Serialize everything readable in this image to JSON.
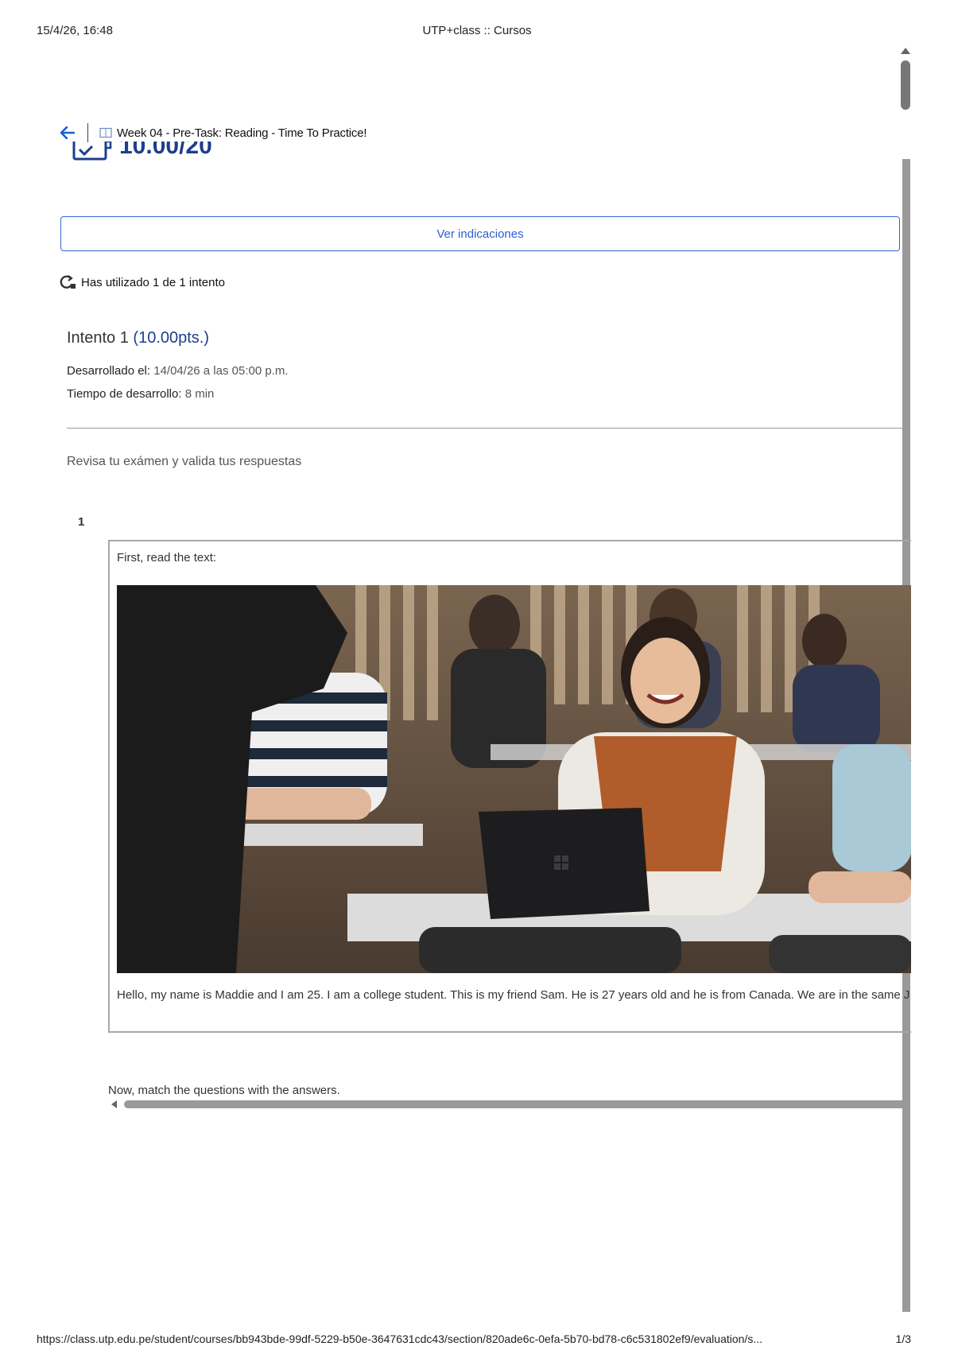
{
  "print_header": {
    "date": "15/4/26, 16:48",
    "title": "UTP+class :: Cursos"
  },
  "nav": {
    "back_icon": "arrow-left-icon",
    "book_icon": "book-icon",
    "title": "Week 04 - Pre-Task: Reading - Time To Practice!"
  },
  "score": {
    "icon": "exam-score-icon",
    "value": "10.00/20"
  },
  "buttons": {
    "ver_indicaciones": "Ver indicaciones"
  },
  "attempts": {
    "icon": "refresh-attempt-icon",
    "text": "Has utilizado 1 de 1 intento"
  },
  "intento": {
    "label": "Intento 1",
    "points": "(10.00pts.)",
    "developed_label": "Desarrollado el:",
    "developed_value": "14/04/26 a las 05:00 p.m.",
    "duration_label": "Tiempo de desarrollo:",
    "duration_value": "8 min"
  },
  "review_text": "Revisa tu exámen y valida tus respuestas",
  "question": {
    "number": "1",
    "intro": "First, read the text:",
    "reading": "Hello, my name is Maddie and I am 25. I am a college student. This is my friend Sam. He is 27 years old and he is from Canada. We are in the same J",
    "match_instruction": "Now, match the questions with the answers."
  },
  "print_footer": {
    "url": "https://class.utp.edu.pe/student/courses/bb943bde-99df-5229-b50e-3647631cdc43/section/820ade6c-0efa-5b70-bd78-c6c531802ef9/evaluation/s...",
    "pages": "1/3"
  },
  "colors": {
    "accent_blue": "#2a5fcf",
    "score_navy": "#1c3f8c"
  }
}
